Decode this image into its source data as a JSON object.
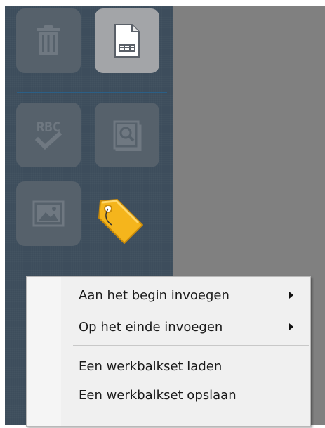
{
  "toolbar": {
    "tools": [
      {
        "name": "trash",
        "icon": "trash-icon",
        "enabled": false
      },
      {
        "name": "page",
        "icon": "document-icon",
        "enabled": true
      },
      {
        "name": "spellcheck",
        "icon": "spellcheck-icon",
        "enabled": false,
        "icon_text": "RBC"
      },
      {
        "name": "find",
        "icon": "magnifier-icon",
        "enabled": false
      },
      {
        "name": "image",
        "icon": "image-icon",
        "enabled": false
      },
      {
        "name": "tag",
        "icon": "tag-icon",
        "enabled": true
      }
    ]
  },
  "context_menu": {
    "items": [
      {
        "label": "Aan het begin invoegen",
        "has_submenu": true
      },
      {
        "label": "Op het einde invoegen",
        "has_submenu": true
      },
      {
        "label": "Een werkbalkset laden",
        "has_submenu": false
      },
      {
        "label": "Een werkbalkset opslaan",
        "has_submenu": false
      }
    ]
  },
  "colors": {
    "toolbar_bg": "#3d4d5c",
    "workspace_bg": "#808080",
    "separator": "#2b5f86",
    "menu_bg": "#f0f0f0",
    "tag": "#f5b51c"
  }
}
